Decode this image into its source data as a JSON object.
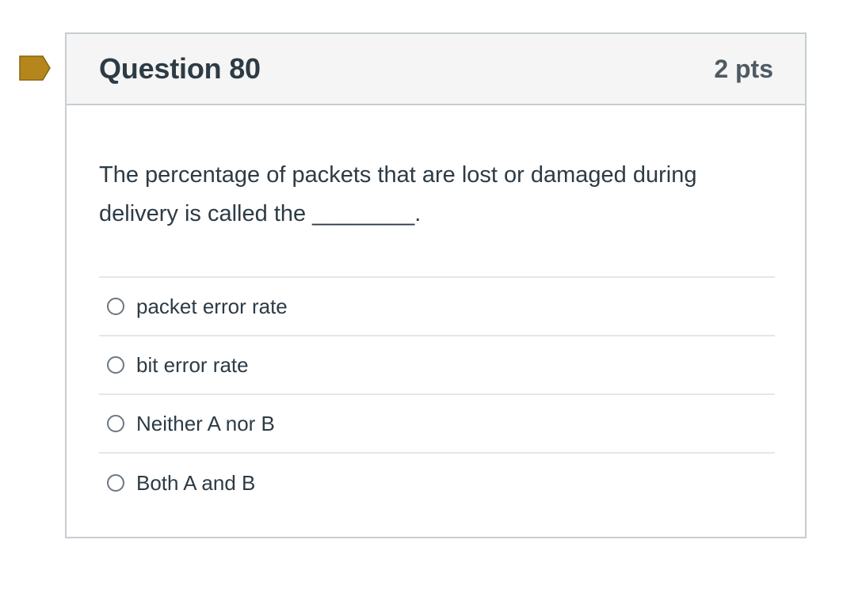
{
  "question": {
    "title": "Question 80",
    "points": "2 pts",
    "text": "The percentage of packets that are lost or damaged during delivery is called the ________.",
    "flag_color": "#b5861c",
    "answers": [
      {
        "label": "packet error rate",
        "selected": false
      },
      {
        "label": "bit error rate",
        "selected": false
      },
      {
        "label": "Neither A nor B",
        "selected": false
      },
      {
        "label": "Both A and B",
        "selected": false
      }
    ]
  }
}
